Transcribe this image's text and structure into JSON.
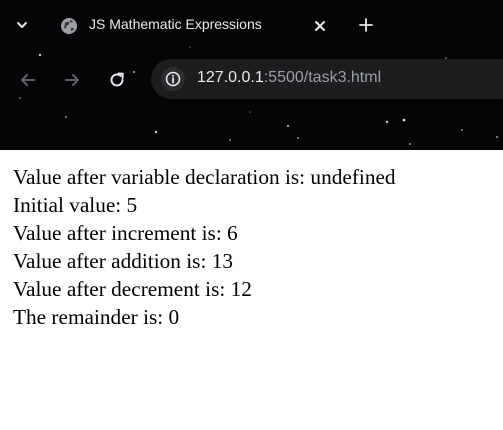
{
  "browser": {
    "tab_title": "JS Mathematic Expressions",
    "tab_favicon": "globe-icon",
    "url_host": "127.0.0.1",
    "url_rest": ":5500/task3.html",
    "colors": {
      "frame": "#050507",
      "omnibox": "#1d1d1f",
      "text": "#e8eaed",
      "url_dim": "#9aa0a6"
    }
  },
  "page": {
    "lines": [
      "Value after variable declaration is: undefined",
      "Initial value: 5",
      "Value after increment is: 6",
      "Value after addition is: 13",
      "Value after decrement is: 12",
      "The remainder is: 0"
    ]
  }
}
